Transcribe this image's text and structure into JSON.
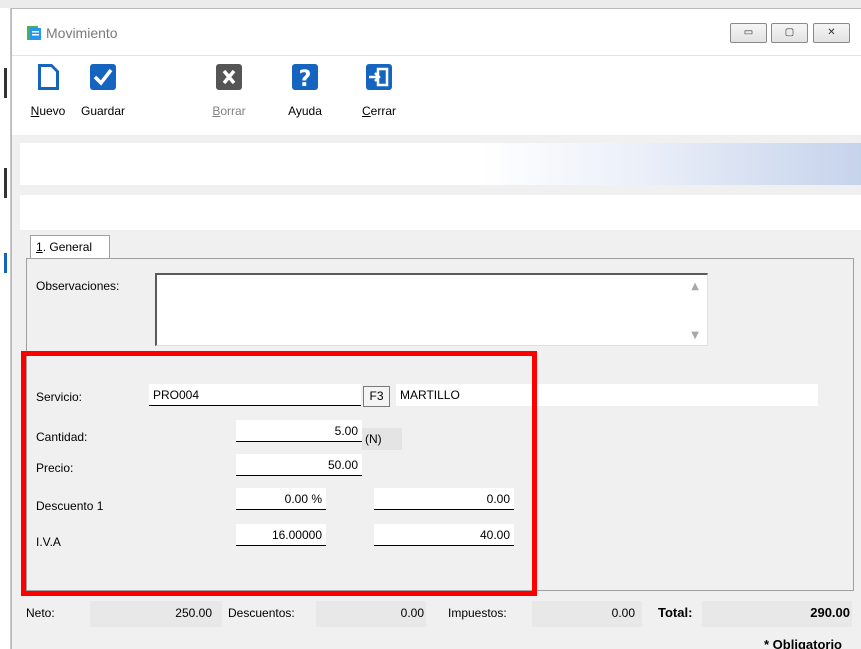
{
  "window": {
    "title": "Movimiento",
    "minimize_glyph": "▭",
    "maximize_glyph": "▢",
    "close_glyph": "✕"
  },
  "toolbar": {
    "buttons": [
      {
        "key": "N",
        "rest": "uevo",
        "icon": "new-document-icon",
        "enabled": true
      },
      {
        "key": "",
        "rest": "Guardar",
        "icon": "checkmark-icon",
        "enabled": true
      },
      {
        "key": "B",
        "rest": "orrar",
        "icon": "delete-x-icon",
        "enabled": false
      },
      {
        "key": "",
        "rest": "Ayuda",
        "icon": "help-question-icon",
        "enabled": true
      },
      {
        "key": "C",
        "rest": "errar",
        "icon": "exit-door-icon",
        "enabled": true
      }
    ]
  },
  "tab": {
    "key": "1",
    "rest": ". General"
  },
  "form": {
    "observaciones_label": "Observaciones:",
    "observaciones_value": "",
    "servicio_label": "Servicio:",
    "servicio_code": "PRO004",
    "lookup_button": "F3",
    "servicio_name": "MARTILLO",
    "cantidad_label": "Cantidad:",
    "cantidad_value": "5.00",
    "cantidad_unit": "(N)",
    "precio_label": "Precio:",
    "precio_value": "50.00",
    "descuento_label": "Descuento 1",
    "descuento_pct": "0.00 %",
    "descuento_amount": "0.00",
    "iva_label": "I.V.A",
    "iva_rate": "16.00000",
    "iva_amount": "40.00"
  },
  "totals": {
    "neto_label": "Neto:",
    "neto_value": "250.00",
    "descuentos_label": "Descuentos:",
    "descuentos_value": "0.00",
    "impuestos_label": "Impuestos:",
    "impuestos_value": "0.00",
    "total_label": "Total:",
    "total_value": "290.00",
    "obligatorio_note": "* Obligatorio"
  },
  "colors": {
    "highlight_border": "#ff0000",
    "icon_blue": "#1565c0",
    "icon_dark": "#555555",
    "window_bg": "#f0f0f0"
  }
}
